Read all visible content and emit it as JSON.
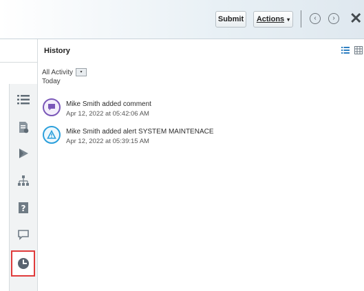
{
  "toolbar": {
    "submit_label": "Submit",
    "actions_label": "Actions",
    "actions_caret": "▾",
    "prev_glyph": "‹",
    "next_glyph": "›",
    "close_glyph": "✕"
  },
  "history": {
    "title": "History",
    "filter_label": "All Activity",
    "filter_glyph": "▾",
    "group_label": "Today",
    "activities": [
      {
        "text": "Mike Smith added comment",
        "time": "Apr 12, 2022 at 05:42:06 AM",
        "icon": "comment-activity-icon",
        "color": "#7a57b8"
      },
      {
        "text": "Mike Smith added alert SYSTEM MAINTENACE",
        "time": "Apr 12, 2022 at 05:39:15 AM",
        "icon": "alert-activity-icon",
        "color": "#2a9fdb"
      }
    ]
  },
  "rail": {
    "items": [
      "list-icon",
      "document-icon",
      "flag-icon",
      "hierarchy-icon",
      "help-doc-icon",
      "chat-icon",
      "history-clock-icon"
    ],
    "selected": "history-clock-icon",
    "highlight_color": "#e03a3a"
  }
}
